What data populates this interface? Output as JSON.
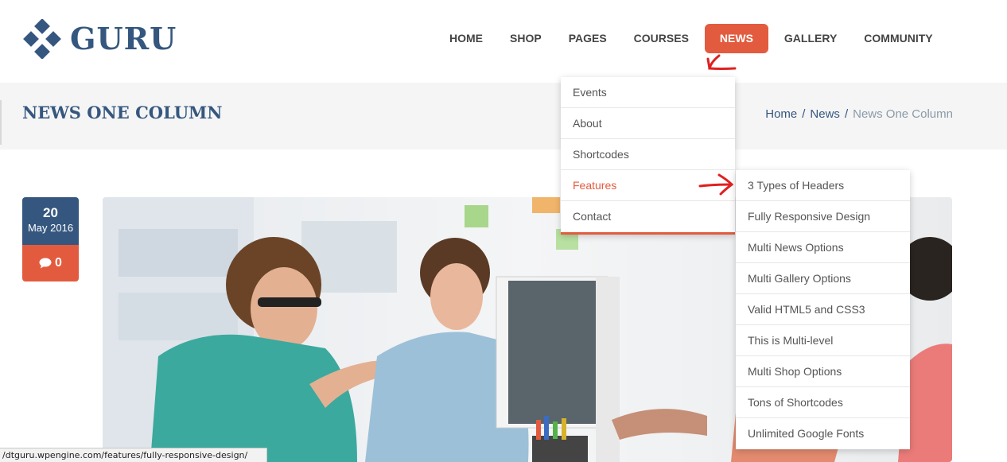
{
  "brand": {
    "name": "GURU",
    "color": "#35577f",
    "accent": "#e35b3e"
  },
  "nav": [
    {
      "label": "HOME"
    },
    {
      "label": "SHOP"
    },
    {
      "label": "PAGES"
    },
    {
      "label": "COURSES"
    },
    {
      "label": "NEWS",
      "active": true
    },
    {
      "label": "GALLERY"
    },
    {
      "label": "COMMUNITY"
    }
  ],
  "page": {
    "title": "NEWS ONE COLUMN",
    "breadcrumb": {
      "home": "Home",
      "sep": "/",
      "parent": "News",
      "current": "News One Column"
    }
  },
  "post": {
    "day": "20",
    "month_year": "May 2016",
    "comments": "0",
    "comment_icon": "speech-bubble-icon",
    "image": "office-team-photo"
  },
  "news_menu": [
    "Events",
    "About",
    "Shortcodes",
    "Features",
    "Contact"
  ],
  "news_menu_highlight": "Features",
  "features_menu": [
    "3 Types of Headers",
    "Fully Responsive Design",
    "Multi News Options",
    "Multi Gallery Options",
    "Valid HTML5 and CSS3",
    "This is Multi-level",
    "Multi Shop Options",
    "Tons of Shortcodes",
    "Unlimited Google Fonts"
  ],
  "status_url": "/dtguru.wpengine.com/features/fully-responsive-design/"
}
